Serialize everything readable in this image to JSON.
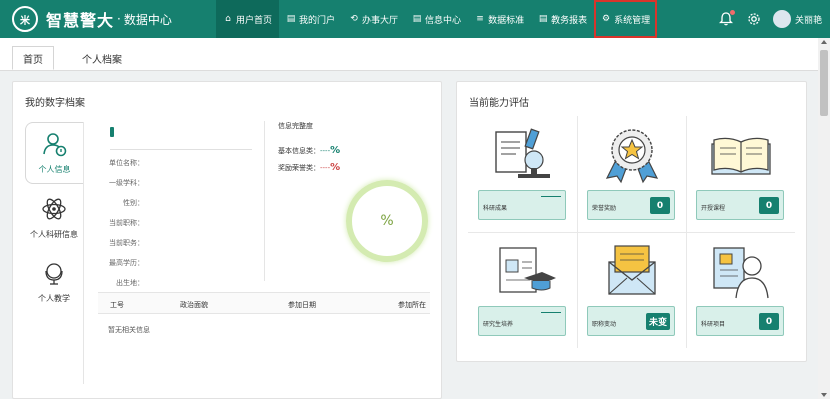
{
  "brand": {
    "logo": "米",
    "name": "智慧警大",
    "dot": "·",
    "subtitle": "数据中心"
  },
  "nav": [
    {
      "icon": "⌂",
      "label": "用户首页",
      "active": true
    },
    {
      "icon": "▤",
      "label": "我的门户"
    },
    {
      "icon": "⟲",
      "label": "办事大厅"
    },
    {
      "icon": "▤",
      "label": "信息中心"
    },
    {
      "icon": "≡",
      "label": "数据标准"
    },
    {
      "icon": "▤",
      "label": "教务报表"
    },
    {
      "icon": "⚙",
      "label": "系统管理"
    }
  ],
  "user": {
    "name": "关丽艳"
  },
  "tabs": {
    "home": "首页",
    "profile": "个人档案"
  },
  "left_panel": {
    "title": "我的数字档案",
    "vtabs": [
      {
        "label": "个人信息",
        "icon": "user-info-icon"
      },
      {
        "label": "个人科研信息",
        "icon": "atom-icon"
      },
      {
        "label": "个人教学",
        "icon": "globe-icon"
      }
    ],
    "fields": [
      "单位名称：",
      "一级学科：",
      "性别：",
      "当前职称：",
      "当前职务：",
      "最高学历：",
      "出生地："
    ],
    "integrity": {
      "title": "信息完整度",
      "basic_label": "基本信息类：",
      "basic_dash": "----",
      "basic_pct": "%",
      "award_label": "奖励荣誉类：",
      "award_dash": "----",
      "award_pct": "%",
      "ring_text": "%"
    },
    "table": {
      "headers": [
        "工号",
        "政治面貌",
        "参加日期",
        "参加所在"
      ],
      "empty": "暂无相关信息"
    }
  },
  "right_panel": {
    "title": "当前能力评估",
    "cells": [
      {
        "label": "科研成果",
        "badge": "",
        "icon": "microscope-icon"
      },
      {
        "label": "荣誉奖励",
        "badge": "0",
        "icon": "medal-icon"
      },
      {
        "label": "开授课程",
        "badge": "0",
        "icon": "book-icon"
      },
      {
        "label": "研究生培养",
        "badge": "",
        "icon": "graduation-icon"
      },
      {
        "label": "职称变动",
        "badge": "未变",
        "icon": "envelope-icon"
      },
      {
        "label": "科研项目",
        "badge": "0",
        "icon": "person-icon"
      }
    ]
  }
}
